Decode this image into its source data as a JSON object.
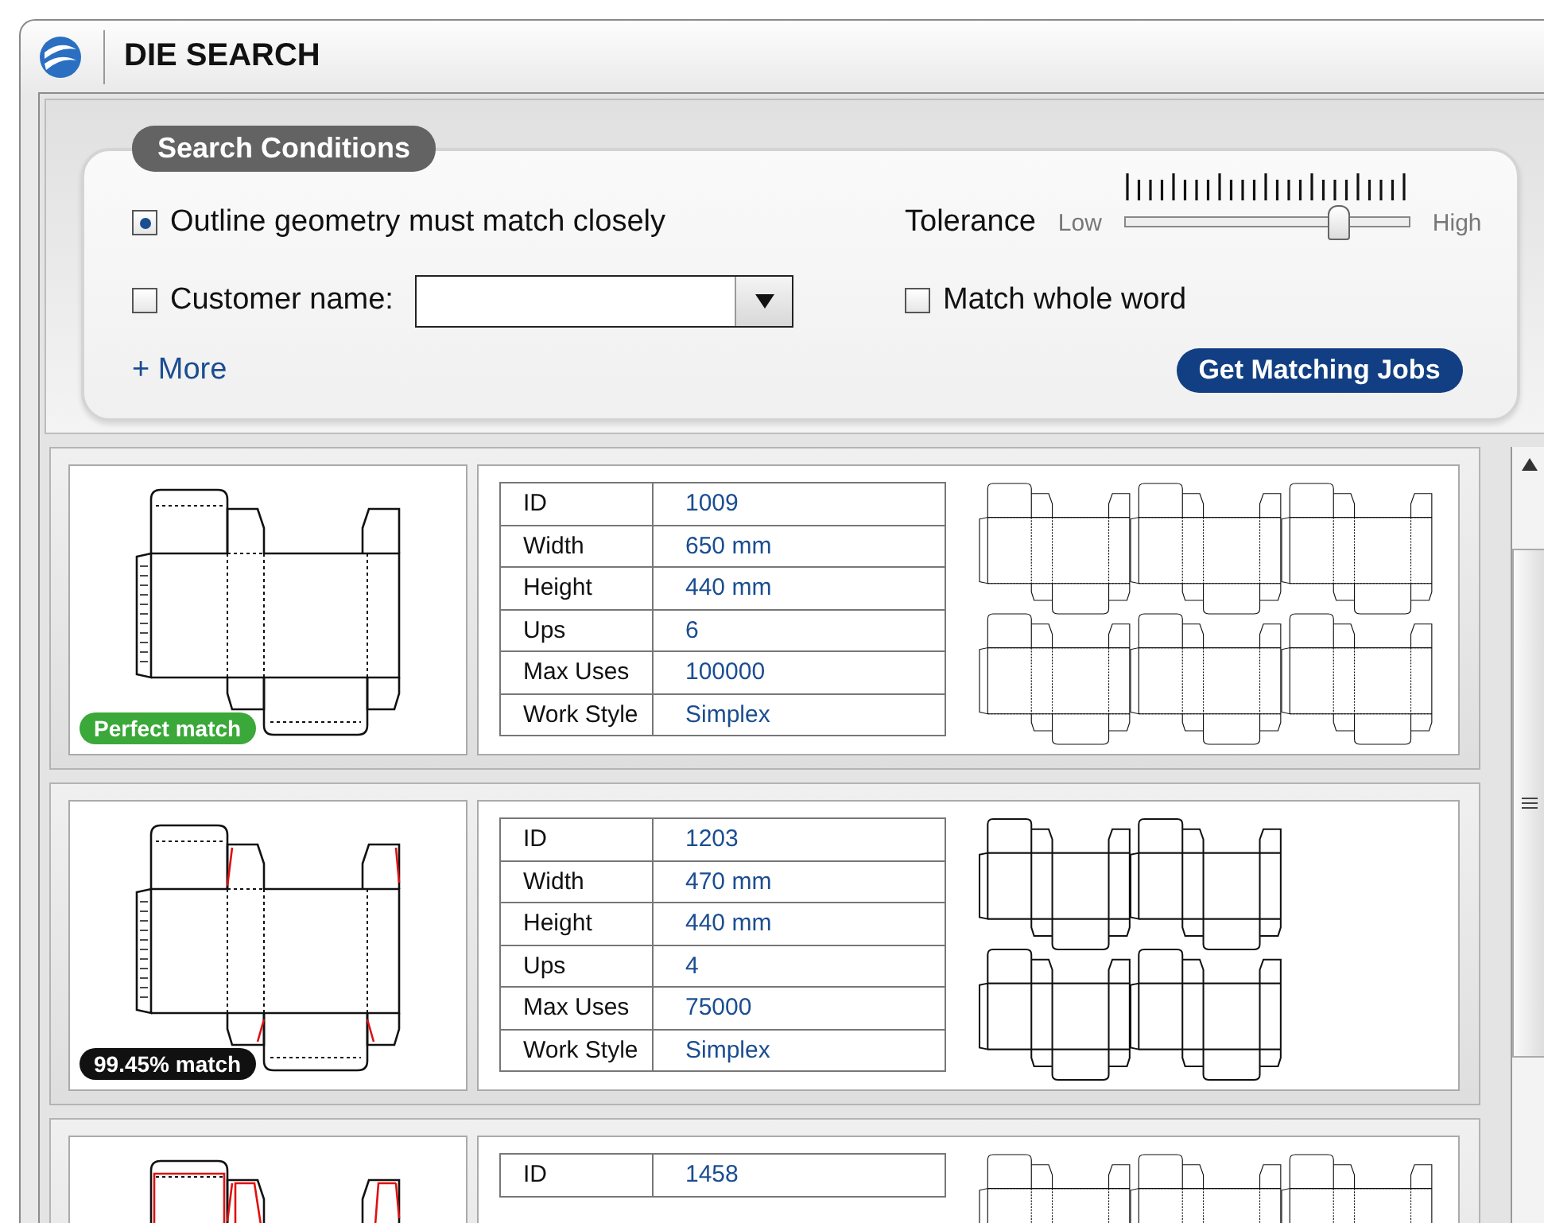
{
  "window": {
    "title": "DIE SEARCH"
  },
  "search": {
    "legend": "Search Conditions",
    "outline_option": {
      "label": "Outline geometry must match closely",
      "checked": true
    },
    "tolerance": {
      "label": "Tolerance",
      "low": "Low",
      "high": "High",
      "level": 0.75
    },
    "customer_option": {
      "label": "Customer name:",
      "checked": false
    },
    "whole_word_option": {
      "label": "Match whole word",
      "checked": false
    },
    "more_link": "+ More",
    "submit_button": "Get Matching Jobs"
  },
  "results": [
    {
      "badge": {
        "text": "Perfect match",
        "kind": "perfect"
      },
      "dieline": {
        "kind": "plain"
      },
      "sheet": {
        "kind": "three-across"
      },
      "fields": [
        {
          "label": "ID",
          "value": "1009"
        },
        {
          "label": "Width",
          "value": "650 mm"
        },
        {
          "label": "Height",
          "value": "440 mm"
        },
        {
          "label": "Ups",
          "value": "6"
        },
        {
          "label": "Max Uses",
          "value": "100000"
        },
        {
          "label": "Work Style",
          "value": "Simplex"
        }
      ]
    },
    {
      "badge": {
        "text": "99.45% match",
        "kind": "partial"
      },
      "dieline": {
        "kind": "minor"
      },
      "sheet": {
        "kind": "two-across"
      },
      "fields": [
        {
          "label": "ID",
          "value": "1203"
        },
        {
          "label": "Width",
          "value": "470 mm"
        },
        {
          "label": "Height",
          "value": "440 mm"
        },
        {
          "label": "Ups",
          "value": "4"
        },
        {
          "label": "Max Uses",
          "value": "75000"
        },
        {
          "label": "Work Style",
          "value": "Simplex"
        }
      ]
    },
    {
      "dieline": {
        "kind": "major"
      },
      "sheet": {
        "kind": "three-across"
      },
      "fields": [
        {
          "label": "ID",
          "value": "1458"
        }
      ]
    }
  ]
}
